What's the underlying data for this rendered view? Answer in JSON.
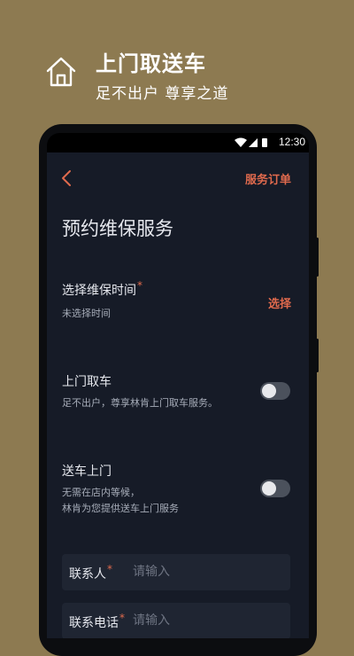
{
  "promo": {
    "title": "上门取送车",
    "subtitle": "足不出户 尊享之道",
    "icon": "home-icon"
  },
  "statusbar": {
    "time": "12:30"
  },
  "header": {
    "back_icon": "chevron-left-icon",
    "orders_label": "服务订单"
  },
  "page_title": "预约维保服务",
  "time_section": {
    "label": "选择维保时间",
    "required_mark": "*",
    "value": "未选择时间",
    "action_label": "选择"
  },
  "pickup_section": {
    "label": "上门取车",
    "description": "足不出户，尊享林肯上门取车服务。",
    "enabled": false
  },
  "delivery_section": {
    "label": "送车上门",
    "description_line1": "无需在店内等候，",
    "description_line2": "林肯为您提供送车上门服务",
    "enabled": false
  },
  "contact_form": {
    "name_label": "联系人",
    "name_required": "*",
    "name_placeholder": "请输入",
    "phone_label": "联系电话",
    "phone_required": "*",
    "phone_placeholder": "请输入"
  },
  "colors": {
    "background": "#8d7a51",
    "screen": "#161b27",
    "accent": "#e06a4d"
  }
}
